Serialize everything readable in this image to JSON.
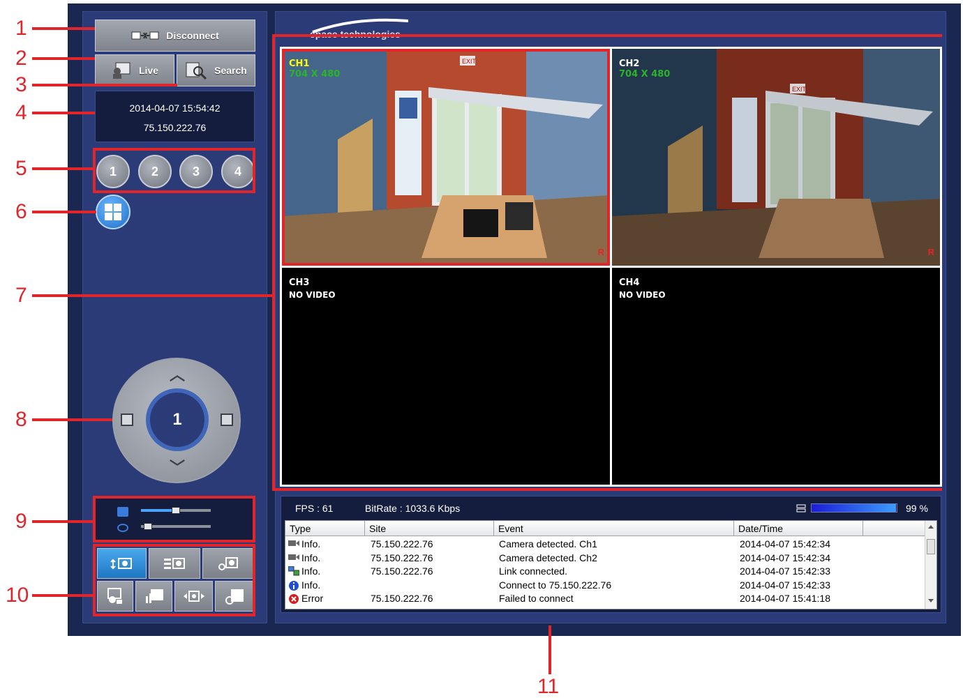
{
  "brand": {
    "logo_text": "space technologies"
  },
  "controls": {
    "disconnect_label": "Disconnect",
    "live_label": "Live",
    "search_label": "Search"
  },
  "connection": {
    "datetime": "2014-04-07 15:54:42",
    "ip": "75.150.222.76"
  },
  "channel_buttons": [
    "1",
    "2",
    "3",
    "4"
  ],
  "ptz": {
    "center_label": "1"
  },
  "audio": {
    "volume_level": 0.5,
    "mic_level": 0.1
  },
  "tiles": [
    {
      "label": "CH1",
      "resolution": "704 X 480",
      "status": "",
      "rec": "R",
      "label_color": "#ffff00"
    },
    {
      "label": "CH2",
      "resolution": "704 X 480",
      "status": "",
      "rec": "R",
      "label_color": "#ffffff"
    },
    {
      "label": "CH3",
      "resolution": "",
      "status": "NO VIDEO",
      "rec": ""
    },
    {
      "label": "CH4",
      "resolution": "",
      "status": "NO VIDEO",
      "rec": ""
    }
  ],
  "stats": {
    "fps": "FPS :  61",
    "bitrate": "BitRate : 1033.6 Kbps",
    "usage_percent": 99,
    "usage_text": "99 %"
  },
  "log": {
    "columns": [
      "Type",
      "Site",
      "Event",
      "Date/Time"
    ],
    "rows": [
      {
        "icon": "camera-icon",
        "type": "Info.",
        "site": "75.150.222.76",
        "event": "Camera detected. Ch1",
        "datetime": "2014-04-07 15:42:34"
      },
      {
        "icon": "camera-icon",
        "type": "Info.",
        "site": "75.150.222.76",
        "event": "Camera detected. Ch2",
        "datetime": "2014-04-07 15:42:34"
      },
      {
        "icon": "network-icon",
        "type": "Info.",
        "site": "75.150.222.76",
        "event": "Link connected.",
        "datetime": "2014-04-07 15:42:33"
      },
      {
        "icon": "info-icon",
        "type": "Info.",
        "site": "",
        "event": "Connect to 75.150.222.76",
        "datetime": "2014-04-07 15:42:33"
      },
      {
        "icon": "error-icon",
        "type": "Error",
        "site": "75.150.222.76",
        "event": "Failed to connect",
        "datetime": "2014-04-07 15:41:18"
      }
    ]
  },
  "callouts": [
    "1",
    "2",
    "3",
    "4",
    "5",
    "6",
    "7",
    "8",
    "9",
    "10",
    "11"
  ],
  "colors": {
    "accent_red": "#e0262b",
    "panel": "#2a3b78",
    "frame": "#1a2750"
  }
}
